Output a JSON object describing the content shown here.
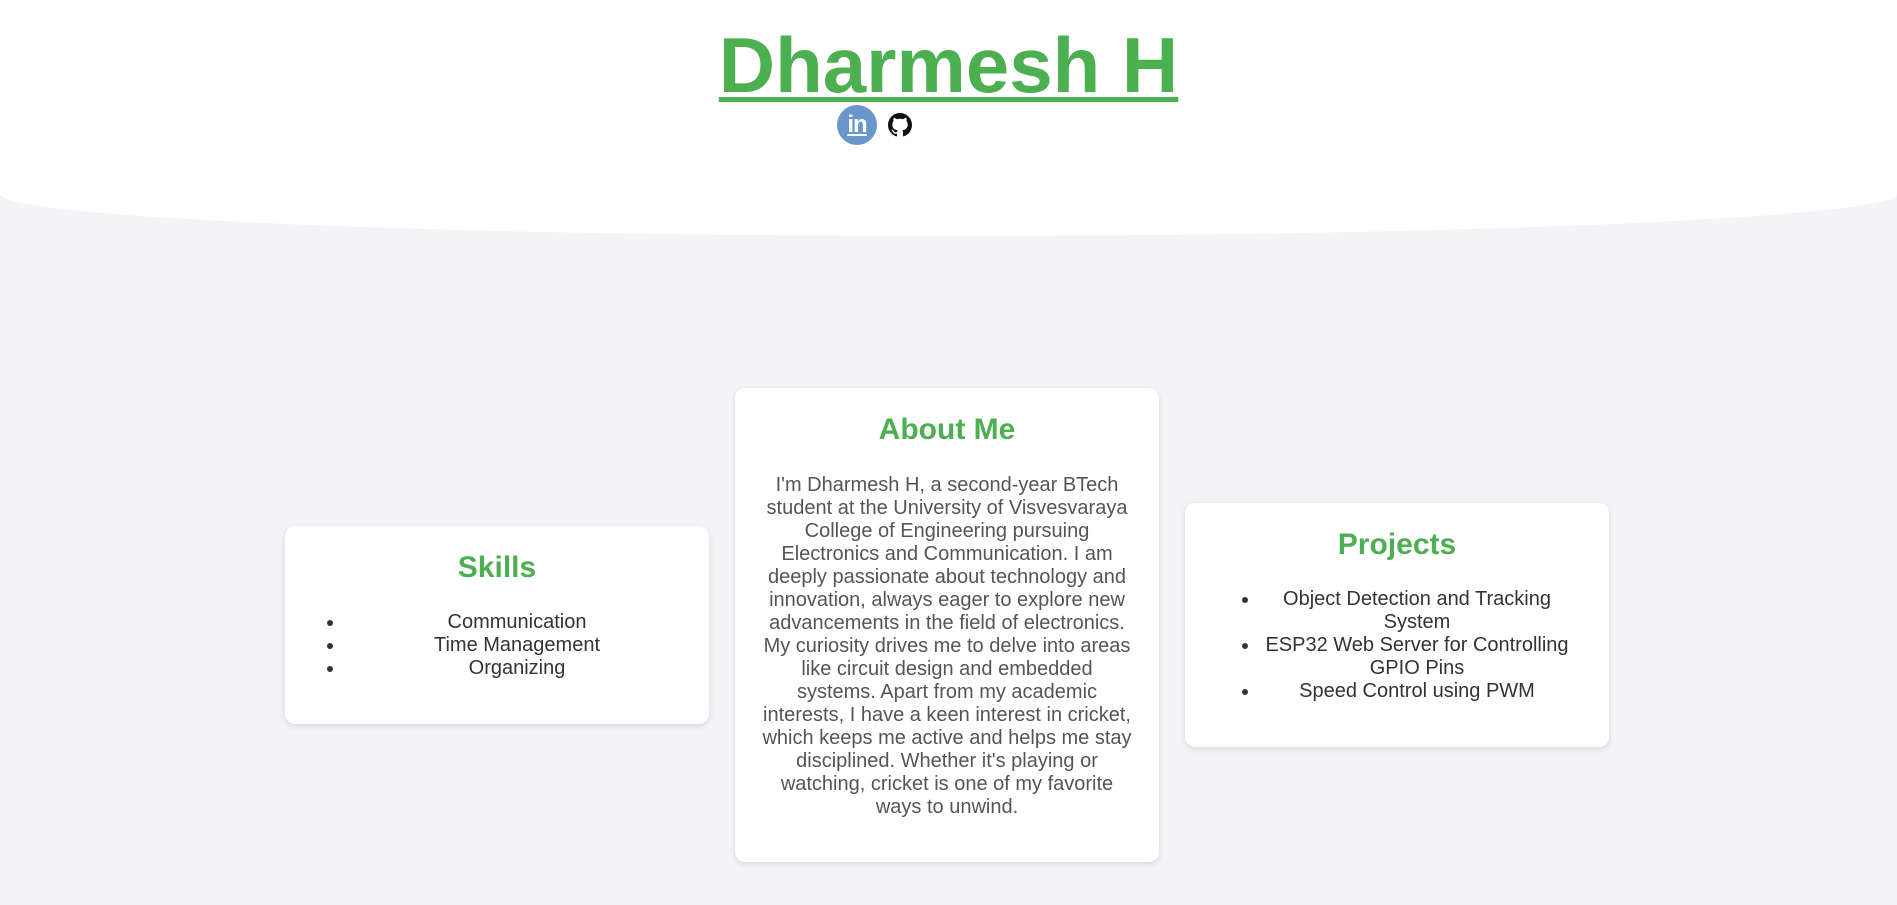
{
  "header": {
    "title": "Dharmesh H",
    "social": {
      "linkedin_label": "in",
      "linkedin_icon": "linkedin-icon",
      "github_icon": "github-icon"
    }
  },
  "skills": {
    "heading": "Skills",
    "items": [
      "Communication",
      "Time Management",
      "Organizing"
    ]
  },
  "about": {
    "heading": "About Me",
    "text": "I'm Dharmesh H, a second-year BTech student at the University of Visvesvaraya College of Engineering pursuing Electronics and Communication. I am deeply passionate about technology and innovation, always eager to explore new advancements in the field of electronics. My curiosity drives me to delve into areas like circuit design and embedded systems. Apart from my academic interests, I have a keen interest in cricket, which keeps me active and helps me stay disciplined. Whether it's playing or watching, cricket is one of my favorite ways to unwind."
  },
  "projects": {
    "heading": "Projects",
    "items": [
      "Object Detection and Tracking System",
      "ESP32 Web Server for Controlling GPIO Pins",
      "Speed Control using PWM"
    ]
  },
  "colors": {
    "accent": "#4caf50",
    "linkedin": "#6a96cb",
    "background": "#f3f3f8"
  }
}
